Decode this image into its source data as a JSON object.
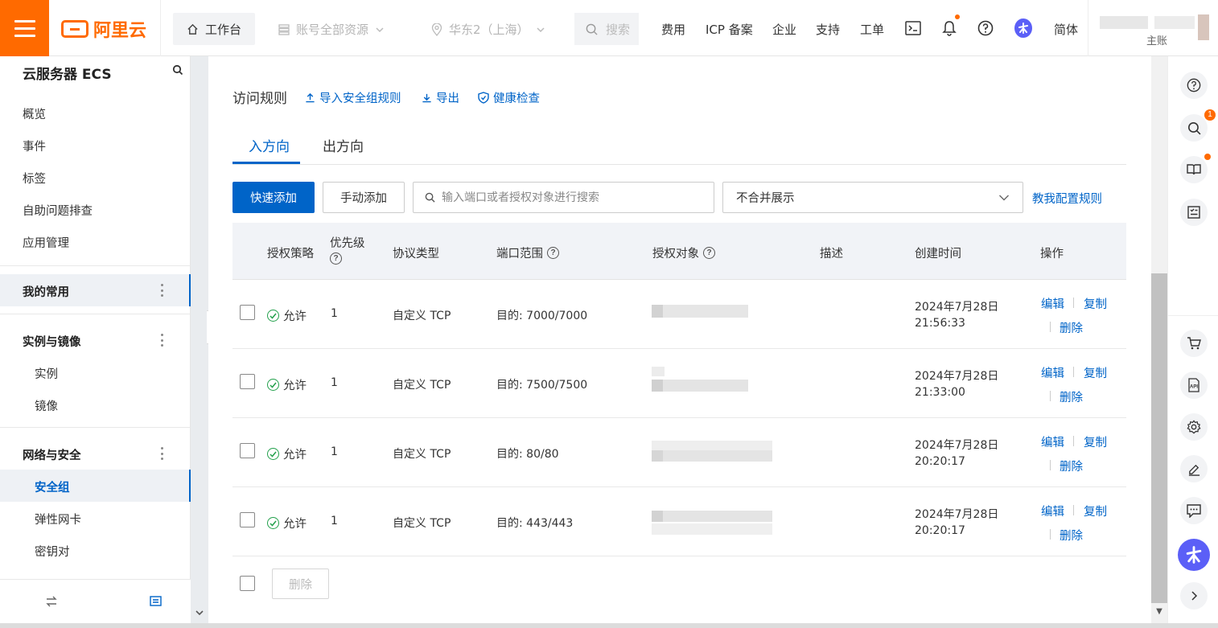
{
  "topbar": {
    "logo_text": "阿里云",
    "workbench": "工作台",
    "resource_scope": "账号全部资源",
    "region": "华东2（上海）",
    "search_placeholder": "搜索",
    "nav": [
      "费用",
      "ICP 备案",
      "企业",
      "支持",
      "工单"
    ],
    "language": "简体",
    "user_partial": "主账"
  },
  "sidebar": {
    "title": "云服务器 ECS",
    "top_items": [
      "概览",
      "事件",
      "标签",
      "自助问题排查",
      "应用管理"
    ],
    "groups": [
      {
        "label": "我的常用",
        "items": []
      },
      {
        "label": "实例与镜像",
        "items": [
          "实例",
          "镜像"
        ]
      },
      {
        "label": "网络与安全",
        "items": [
          "安全组",
          "弹性网卡",
          "密钥对"
        ]
      }
    ],
    "active_item": "安全组"
  },
  "main": {
    "section_title": "访问规则",
    "actions": [
      "导入安全组规则",
      "导出",
      "健康检查"
    ],
    "tabs": [
      {
        "label": "入方向",
        "active": true
      },
      {
        "label": "出方向",
        "active": false
      }
    ],
    "quick_add": "快速添加",
    "manual_add": "手动添加",
    "filter_placeholder": "输入端口或者授权对象进行搜索",
    "merge_option": "不合并展示",
    "help_link": "教我配置规则",
    "columns": [
      "授权策略",
      "优先级",
      "协议类型",
      "端口范围",
      "授权对象",
      "描述",
      "创建时间",
      "操作"
    ],
    "rows": [
      {
        "policy": "允许",
        "priority": "1",
        "protocol": "自定义 TCP",
        "port": "目的: 7000/7000",
        "date": "2024年7月28日",
        "time": "21:56:33"
      },
      {
        "policy": "允许",
        "priority": "1",
        "protocol": "自定义 TCP",
        "port": "目的: 7500/7500",
        "date": "2024年7月28日",
        "time": "21:33:00"
      },
      {
        "policy": "允许",
        "priority": "1",
        "protocol": "自定义 TCP",
        "port": "目的: 80/80",
        "date": "2024年7月28日",
        "time": "20:20:17"
      },
      {
        "policy": "允许",
        "priority": "1",
        "protocol": "自定义 TCP",
        "port": "目的: 443/443",
        "date": "2024年7月28日",
        "time": "20:20:17"
      }
    ],
    "row_ops": [
      "编辑",
      "复制",
      "删除"
    ],
    "bulk_delete": "删除"
  },
  "rail": {
    "search_badge": "1"
  },
  "colors": {
    "brand": "#ff6a00",
    "primary": "#0064c8",
    "success": "#22a04b"
  }
}
